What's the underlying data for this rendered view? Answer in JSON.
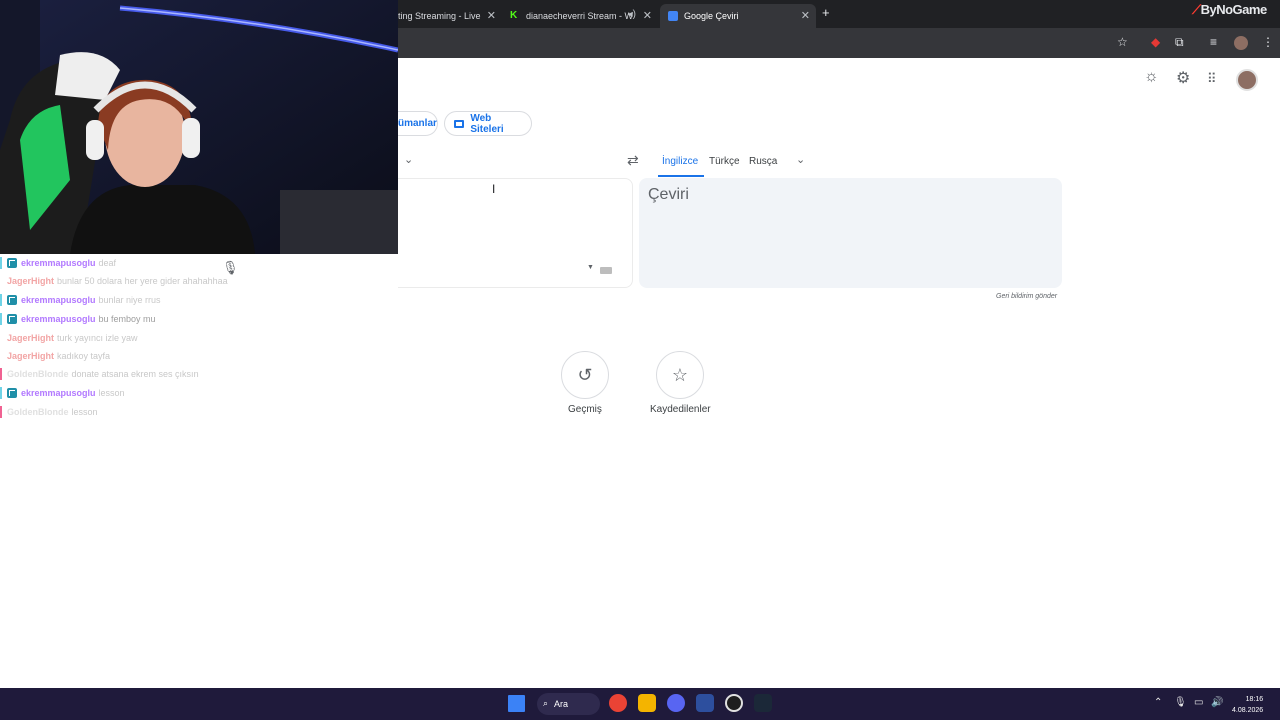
{
  "browser": {
    "tabs": [
      {
        "title": "ting Streaming - Live"
      },
      {
        "title": "dianaecheverri Stream - W"
      },
      {
        "title": "Google Çeviri"
      }
    ],
    "brand": "ByNoGame"
  },
  "translate": {
    "chips": [
      {
        "label": "ümanlar"
      },
      {
        "label": "Web Siteleri"
      }
    ],
    "target_languages": [
      "İngilizce",
      "Türkçe",
      "Rusça"
    ],
    "active_target": "İngilizce",
    "target_placeholder": "Çeviri",
    "feedback_link": "Geri bildirim gönder",
    "history_label": "Geçmiş",
    "saved_label": "Kaydedilenler"
  },
  "chat": {
    "messages": [
      {
        "user": "ekremmapusoglu",
        "text": "deaf",
        "user_color": "#b279ff",
        "bar": "#6fd3e6",
        "badge": true
      },
      {
        "user": "JagerHight",
        "text": "bunlar 50 dolara her yere gider ahahahhaa",
        "user_color": "#f2a5a5",
        "bar": "#ffffff",
        "badge": false
      },
      {
        "user": "ekremmapusoglu",
        "text": "bunlar niye rrus",
        "user_color": "#b279ff",
        "bar": "#6fd3e6",
        "badge": true
      },
      {
        "user": "ekremmapusoglu",
        "text": "bu femboy mu",
        "user_color": "#b279ff",
        "bar": "#6fd3e6",
        "badge": true
      },
      {
        "user": "JagerHight",
        "text": "turk yayıncı izle yaw",
        "user_color": "#f2a5a5",
        "bar": "#ffffff",
        "badge": false
      },
      {
        "user": "JagerHight",
        "text": "kadıkoy tayfa",
        "user_color": "#f2a5a5",
        "bar": "#ffffff",
        "badge": false
      },
      {
        "user": "GoldenBlonde",
        "text": "donate atsana ekrem ses çıksın",
        "user_color": "#e0e0e0",
        "bar": "#f06292",
        "badge": false
      },
      {
        "user": "ekremmapusoglu",
        "text": "lesson",
        "user_color": "#b279ff",
        "bar": "#6fd3e6",
        "badge": true
      },
      {
        "user": "GoldenBlonde",
        "text": "lesson",
        "user_color": "#e0e0e0",
        "bar": "#f06292",
        "badge": false
      }
    ]
  },
  "taskbar": {
    "search_label": "Ara",
    "time": "18:16",
    "date": "4.08.2026"
  },
  "colors": {
    "accent": "#1a73e8",
    "taskbar": "#1f1a3b",
    "chrome_dark": "#202124"
  }
}
